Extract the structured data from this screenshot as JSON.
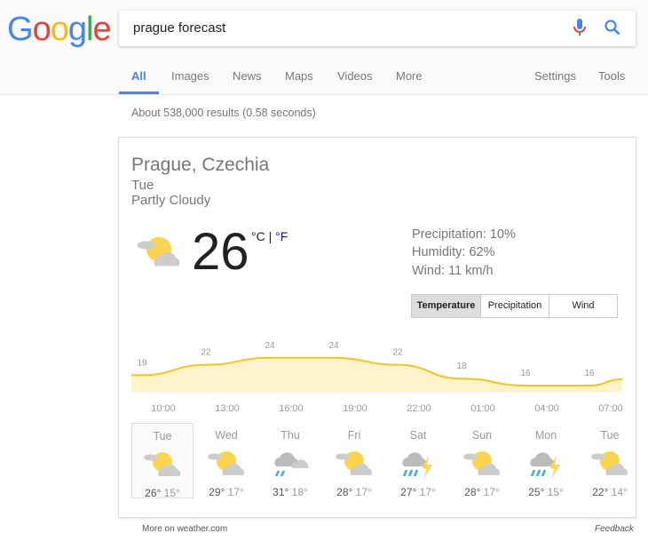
{
  "logo": "Google",
  "search": {
    "query": "prague forecast"
  },
  "tabs": [
    "All",
    "Images",
    "News",
    "Maps",
    "Videos",
    "More"
  ],
  "right_tabs": [
    "Settings",
    "Tools"
  ],
  "stats": "About 538,000 results (0.58 seconds)",
  "weather": {
    "location": "Prague, Czechia",
    "day": "Tue",
    "condition": "Partly Cloudy",
    "temp": "26",
    "unit_c": "°C",
    "unit_sep": " | ",
    "unit_f": "°F",
    "precipitation": "Precipitation: 10%",
    "humidity": "Humidity: 62%",
    "wind": "Wind: 11 km/h",
    "buttons": [
      "Temperature",
      "Precipitation",
      "Wind"
    ],
    "selected_button": "Temperature"
  },
  "chart_data": {
    "type": "area",
    "values": [
      19,
      22,
      24,
      24,
      22,
      18,
      16,
      16
    ],
    "x_ticks": [
      "10:00",
      "13:00",
      "16:00",
      "19:00",
      "22:00",
      "01:00",
      "04:00",
      "07:00"
    ],
    "color": "#f5c518",
    "fill": "#fdf3cc"
  },
  "days": [
    {
      "name": "Tue",
      "hi": "26°",
      "lo": "15°",
      "icon": "partly-cloudy"
    },
    {
      "name": "Wed",
      "hi": "29°",
      "lo": "17°",
      "icon": "partly-cloudy"
    },
    {
      "name": "Thu",
      "hi": "31°",
      "lo": "18°",
      "icon": "rain"
    },
    {
      "name": "Fri",
      "hi": "28°",
      "lo": "17°",
      "icon": "partly-cloudy"
    },
    {
      "name": "Sat",
      "hi": "27°",
      "lo": "17°",
      "icon": "thunderstorm"
    },
    {
      "name": "Sun",
      "hi": "28°",
      "lo": "17°",
      "icon": "partly-cloudy"
    },
    {
      "name": "Mon",
      "hi": "25°",
      "lo": "15°",
      "icon": "thunderstorm"
    },
    {
      "name": "Tue",
      "hi": "22°",
      "lo": "14°",
      "icon": "partly-cloudy"
    }
  ],
  "footer": {
    "more": "More on weather.com",
    "feedback": "Feedback"
  }
}
